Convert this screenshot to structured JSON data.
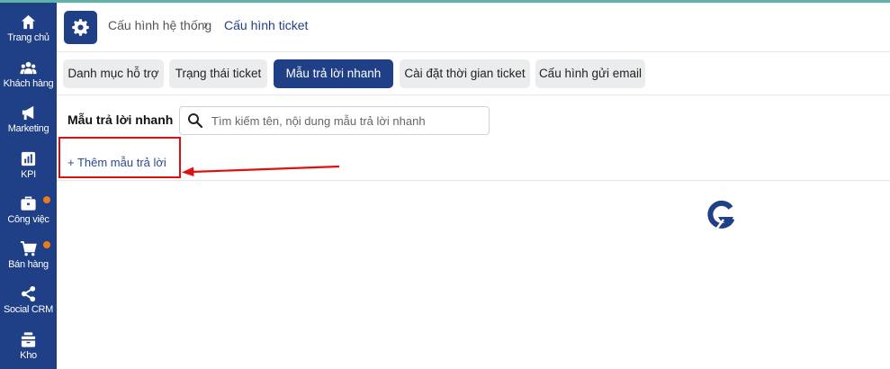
{
  "sidebar": {
    "items": [
      {
        "label": "Trang chủ",
        "icon": "home-icon"
      },
      {
        "label": "Khách hàng",
        "icon": "users-icon"
      },
      {
        "label": "Marketing",
        "icon": "megaphone-icon"
      },
      {
        "label": "KPI",
        "icon": "chart-icon"
      },
      {
        "label": "Công việc",
        "icon": "briefcase-icon",
        "badge": true
      },
      {
        "label": "Bán hàng",
        "icon": "cart-icon",
        "badge": true
      },
      {
        "label": "Social CRM",
        "icon": "share-icon"
      },
      {
        "label": "Kho",
        "icon": "warehouse-icon"
      }
    ]
  },
  "header": {
    "breadcrumb": [
      "Cấu hình hệ thống",
      "Cấu hình ticket"
    ]
  },
  "tabs": [
    {
      "label": "Danh mục hỗ trợ",
      "active": false
    },
    {
      "label": "Trạng thái ticket",
      "active": false
    },
    {
      "label": "Mẫu trả lời nhanh",
      "active": true
    },
    {
      "label": "Cài đặt thời gian ticket",
      "active": false
    },
    {
      "label": "Cấu hình gửi email",
      "active": false
    }
  ],
  "main": {
    "title": "Mẫu trả lời nhanh",
    "search_placeholder": "Tìm kiếm tên, nội dung mẫu trả lời nhanh",
    "search_value": "",
    "add_label": "+ Thêm mẫu trả lời"
  },
  "colors": {
    "primary": "#1f3f87",
    "badge": "#f07a1a",
    "annotation": "#e01010"
  }
}
